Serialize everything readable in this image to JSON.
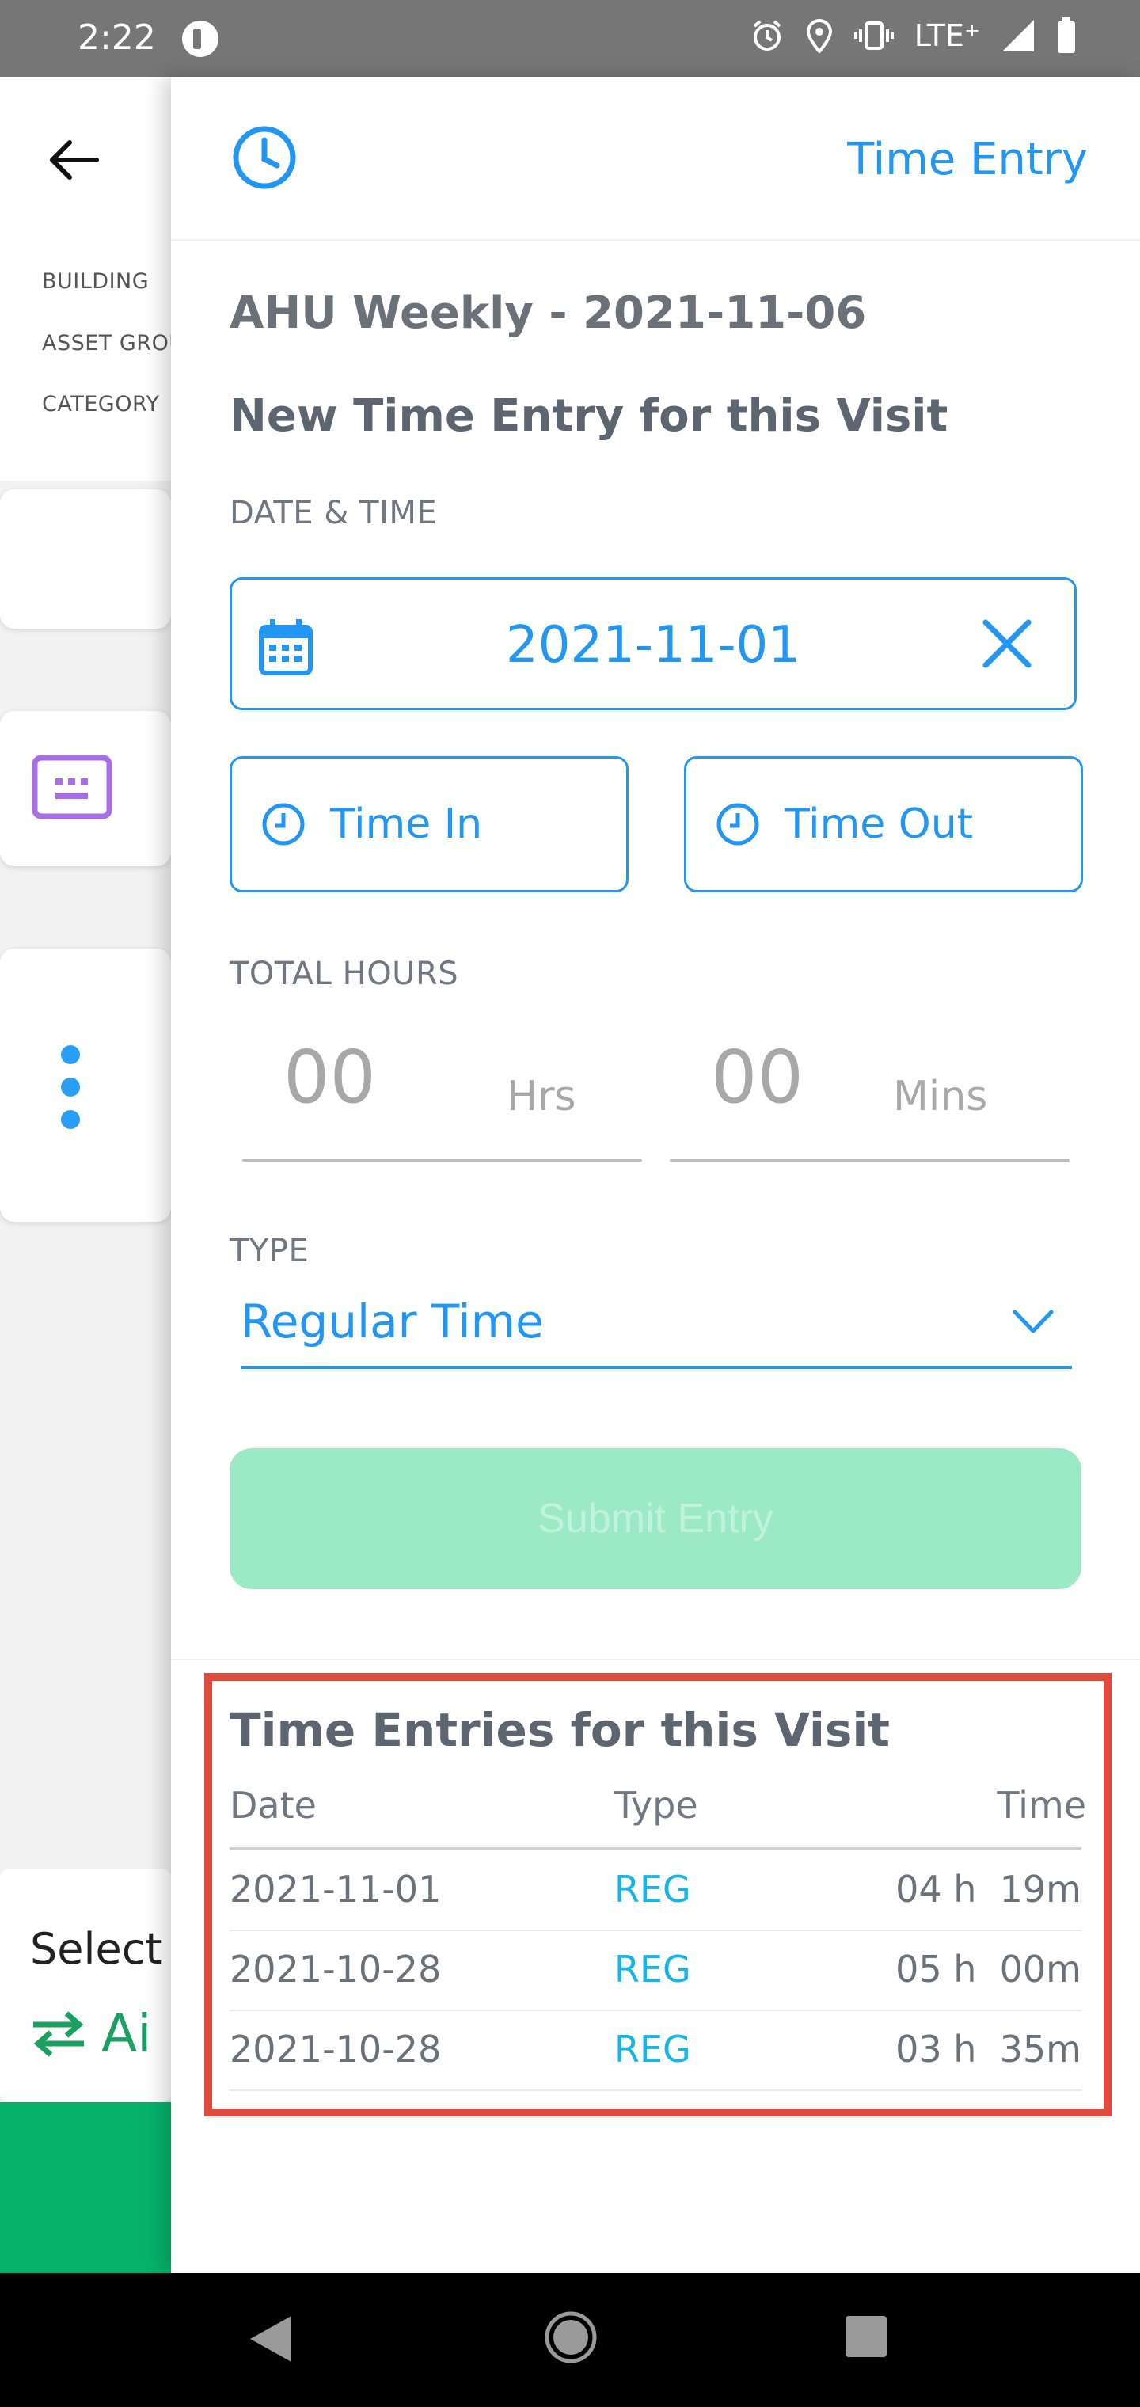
{
  "status_bar": {
    "time": "2:22",
    "network": "LTE⁺"
  },
  "background": {
    "labels": [
      "BUILDING",
      "ASSET GROU",
      "CATEGORY"
    ],
    "select_text": "Select",
    "select_value": "Ai"
  },
  "drawer": {
    "header_title": "Time Entry",
    "visit_title": "AHU Weekly - 2021-11-06",
    "section_title": "New Time Entry for this Visit",
    "date_time_label": "DATE & TIME",
    "date_value": "2021-11-01",
    "time_in_label": "Time In",
    "time_out_label": "Time Out",
    "total_hours_label": "TOTAL HOURS",
    "hours_value": "00",
    "hours_unit": "Hrs",
    "mins_value": "00",
    "mins_unit": "Mins",
    "type_label": "TYPE",
    "type_value": "Regular Time",
    "submit_label": "Submit Entry",
    "entries": {
      "title": "Time Entries for this Visit",
      "columns": [
        "Date",
        "Type",
        "Time"
      ],
      "rows": [
        {
          "date": "2021-11-01",
          "type": "REG",
          "time": "04 h  19m"
        },
        {
          "date": "2021-10-28",
          "type": "REG",
          "time": "05 h  00m"
        },
        {
          "date": "2021-10-28",
          "type": "REG",
          "time": "03 h  35m"
        }
      ]
    }
  },
  "colors": {
    "accent": "#2196f3",
    "submit_bg": "#9ceac5",
    "type_badge": "#17b5e6",
    "highlight_box": "#e14b3d"
  },
  "icons": [
    "back-arrow-icon",
    "clock-icon",
    "calendar-icon",
    "close-icon",
    "chevron-down-icon",
    "keyboard-icon",
    "more-vert-icon",
    "swap-icon"
  ]
}
